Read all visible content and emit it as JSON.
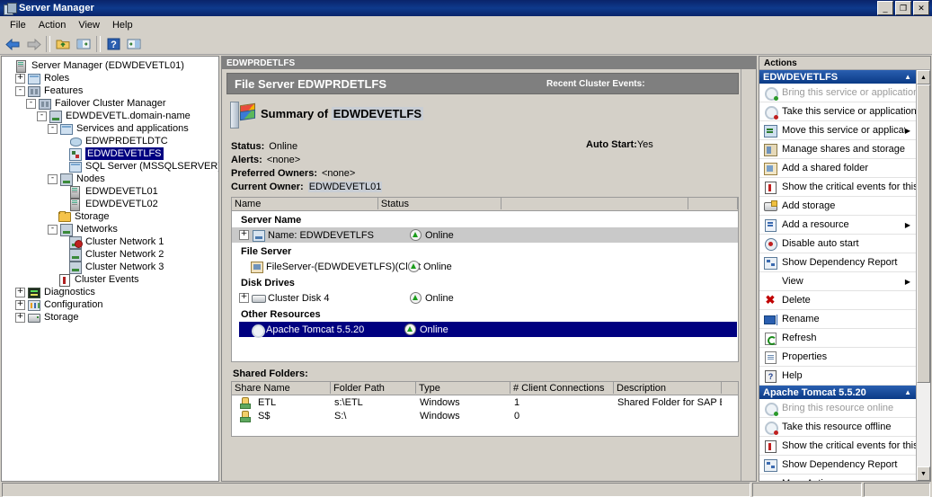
{
  "window": {
    "title": "Server Manager",
    "icon": "server-manager-icon",
    "buttons": {
      "minimize": "_",
      "restore": "❐",
      "close": "✕"
    }
  },
  "menu": {
    "items": [
      "File",
      "Action",
      "View",
      "Help"
    ]
  },
  "toolbar": {
    "items": [
      {
        "name": "back-button",
        "icon": "back-arrow-icon"
      },
      {
        "name": "forward-button",
        "icon": "forward-arrow-icon"
      },
      {
        "name": "up-one-level-button",
        "icon": "folder-up-icon"
      },
      {
        "name": "show-hide-console-tree-button",
        "icon": "console-tree-icon"
      },
      {
        "name": "help-button",
        "icon": "question-mark-icon"
      },
      {
        "name": "show-hide-action-pane-button",
        "icon": "action-pane-icon"
      }
    ]
  },
  "tree": {
    "nodes": [
      {
        "label": "Server Manager (EDWDEVETL01)",
        "indent": 0,
        "expander": "",
        "icon": "server-manager-icon",
        "selected": false
      },
      {
        "label": "Roles",
        "indent": 1,
        "expander": "+",
        "icon": "roles-icon",
        "selected": false
      },
      {
        "label": "Features",
        "indent": 1,
        "expander": "-",
        "icon": "features-icon",
        "selected": false
      },
      {
        "label": "Failover Cluster Manager",
        "indent": 2,
        "expander": "-",
        "icon": "cluster-icon",
        "selected": false
      },
      {
        "label": "EDWDEVETL.domain-name",
        "indent": 3,
        "expander": "-",
        "icon": "cluster-node-icon",
        "selected": false
      },
      {
        "label": "Services and applications",
        "indent": 4,
        "expander": "-",
        "icon": "services-icon",
        "selected": false
      },
      {
        "label": "EDWPRDETLDTC",
        "indent": 5,
        "expander": "",
        "icon": "dtc-icon",
        "selected": false
      },
      {
        "label": "EDWDEVETLFS",
        "indent": 5,
        "expander": "",
        "icon": "file-server-icon",
        "selected": true
      },
      {
        "label": "SQL Server (MSSQLSERVER)",
        "indent": 5,
        "expander": "",
        "icon": "sql-server-icon",
        "selected": false
      },
      {
        "label": "Nodes",
        "indent": 4,
        "expander": "-",
        "icon": "nodes-icon",
        "selected": false
      },
      {
        "label": "EDWDEVETL01",
        "indent": 5,
        "expander": "",
        "icon": "node-icon",
        "selected": false
      },
      {
        "label": "EDWDEVETL02",
        "indent": 5,
        "expander": "",
        "icon": "node-icon",
        "selected": false
      },
      {
        "label": "Storage",
        "indent": 4,
        "expander": "",
        "icon": "storage-folder-icon",
        "selected": false
      },
      {
        "label": "Networks",
        "indent": 4,
        "expander": "-",
        "icon": "networks-icon",
        "selected": false
      },
      {
        "label": "Cluster Network 1",
        "indent": 5,
        "expander": "",
        "icon": "network-error-icon",
        "selected": false
      },
      {
        "label": "Cluster Network 2",
        "indent": 5,
        "expander": "",
        "icon": "network-icon",
        "selected": false
      },
      {
        "label": "Cluster Network 3",
        "indent": 5,
        "expander": "",
        "icon": "network-icon",
        "selected": false
      },
      {
        "label": "Cluster Events",
        "indent": 4,
        "expander": "",
        "icon": "events-icon",
        "selected": false
      },
      {
        "label": "Diagnostics",
        "indent": 1,
        "expander": "+",
        "icon": "diagnostics-icon",
        "selected": false
      },
      {
        "label": "Configuration",
        "indent": 1,
        "expander": "+",
        "icon": "configuration-icon",
        "selected": false
      },
      {
        "label": "Storage",
        "indent": 1,
        "expander": "+",
        "icon": "storage-icon",
        "selected": false
      }
    ]
  },
  "center": {
    "caption": "EDWPRDETLFS",
    "header": {
      "title": "File Server EDWPRDETLFS",
      "recent_events_label": "Recent Cluster Events:"
    },
    "summary": {
      "prefix": "Summary of",
      "name": "EDWDEVETLFS",
      "icon": "file-server-summary-icon"
    },
    "status": {
      "status_label": "Status:",
      "status_value": "Online",
      "alerts_label": "Alerts:",
      "alerts_value": "<none>",
      "preferred_label": "Preferred Owners:",
      "preferred_value": "<none>",
      "owner_label": "Current Owner:",
      "owner_value": "EDWDEVETL01",
      "autostart_label": "Auto Start:",
      "autostart_value": "Yes"
    },
    "resources": {
      "columns": [
        "Name",
        "Status",
        "",
        ""
      ],
      "groups": [
        {
          "title": "Server Name",
          "rows": [
            {
              "expander": "+",
              "icon": "network-name-icon",
              "name": "Name: EDWDEVETLFS",
              "status": "Online",
              "shaded": true,
              "selected": false
            }
          ]
        },
        {
          "title": "File Server",
          "rows": [
            {
              "expander": "",
              "icon": "file-server-resource-icon",
              "name": "FileServer-(EDWDEVETLFS)(Clust",
              "status": "Online",
              "shaded": false,
              "selected": false
            }
          ]
        },
        {
          "title": "Disk Drives",
          "rows": [
            {
              "expander": "+",
              "icon": "disk-icon",
              "name": "Cluster Disk 4",
              "status": "Online",
              "shaded": false,
              "selected": false
            }
          ]
        },
        {
          "title": "Other Resources",
          "rows": [
            {
              "expander": "",
              "icon": "generic-service-icon",
              "name": "Apache Tomcat 5.5.20",
              "status": "Online",
              "shaded": false,
              "selected": true
            }
          ]
        }
      ]
    },
    "shared_folders": {
      "label": "Shared Folders:",
      "columns": [
        "Share Name",
        "Folder Path",
        "Type",
        "# Client Connections",
        "Description"
      ],
      "rows": [
        {
          "share": "ETL",
          "path": "s:\\ETL",
          "type": "Windows",
          "connections": "1",
          "description": "Shared Folder for SAP BO"
        },
        {
          "share": "S$",
          "path": "S:\\",
          "type": "Windows",
          "connections": "0",
          "description": ""
        }
      ]
    }
  },
  "actions": {
    "header": "Actions",
    "groups": [
      {
        "title": "EDWDEVETLFS",
        "items": [
          {
            "label": "Bring this service or application ...",
            "icon": "bring-online-icon",
            "disabled": true,
            "submenu": false
          },
          {
            "label": "Take this service or application ...",
            "icon": "take-offline-icon",
            "disabled": false,
            "submenu": false
          },
          {
            "label": "Move this service or application ...",
            "icon": "move-icon",
            "disabled": false,
            "submenu": true
          },
          {
            "label": "Manage shares and storage",
            "icon": "manage-shares-icon",
            "disabled": false,
            "submenu": false
          },
          {
            "label": "Add a shared folder",
            "icon": "add-shared-folder-icon",
            "disabled": false,
            "submenu": false
          },
          {
            "label": "Show the critical events for this ...",
            "icon": "critical-events-icon",
            "disabled": false,
            "submenu": false
          },
          {
            "label": "Add storage",
            "icon": "add-storage-icon",
            "disabled": false,
            "submenu": false
          },
          {
            "label": "Add a resource",
            "icon": "add-resource-icon",
            "disabled": false,
            "submenu": true
          },
          {
            "label": "Disable auto start",
            "icon": "disable-auto-start-icon",
            "disabled": false,
            "submenu": false
          },
          {
            "label": "Show Dependency Report",
            "icon": "dependency-report-icon",
            "disabled": false,
            "submenu": false
          },
          {
            "label": "View",
            "icon": "",
            "disabled": false,
            "submenu": true
          },
          {
            "label": "Delete",
            "icon": "delete-icon",
            "disabled": false,
            "submenu": false
          },
          {
            "label": "Rename",
            "icon": "rename-icon",
            "disabled": false,
            "submenu": false
          },
          {
            "label": "Refresh",
            "icon": "refresh-icon",
            "disabled": false,
            "submenu": false
          },
          {
            "label": "Properties",
            "icon": "properties-icon",
            "disabled": false,
            "submenu": false
          },
          {
            "label": "Help",
            "icon": "help-icon",
            "disabled": false,
            "submenu": false
          }
        ]
      },
      {
        "title": "Apache Tomcat 5.5.20",
        "items": [
          {
            "label": "Bring this resource online",
            "icon": "bring-online-icon",
            "disabled": true,
            "submenu": false
          },
          {
            "label": "Take this resource offline",
            "icon": "take-offline-icon",
            "disabled": false,
            "submenu": false
          },
          {
            "label": "Show the critical events for this ...",
            "icon": "critical-events-icon",
            "disabled": false,
            "submenu": false
          },
          {
            "label": "Show Dependency Report",
            "icon": "dependency-report-icon",
            "disabled": false,
            "submenu": false
          },
          {
            "label": "More Actions...",
            "icon": "",
            "disabled": false,
            "submenu": true
          }
        ]
      }
    ]
  },
  "colors": {
    "title_bar": "#0a246a",
    "window_face": "#d4d0c8",
    "panel_header": "#808080",
    "selection": "#000080",
    "action_group": "#0a3a86",
    "online_green": "#1a9c1a"
  }
}
